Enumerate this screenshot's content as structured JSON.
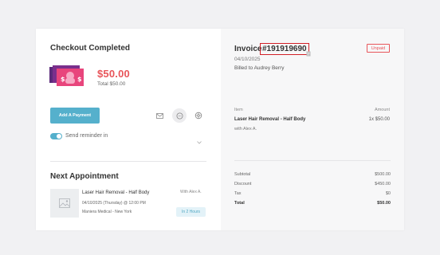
{
  "checkout": {
    "title": "Checkout Completed",
    "amount": "$50.00",
    "total_line": "Total $50.00",
    "pay_button": "Add A Payment",
    "reminder_label": "Send reminder in",
    "reminder_enabled": true
  },
  "next_appointment": {
    "title": "Next Appointment",
    "service": "Laser Hair Removal - Half Body",
    "date": "04/10/2025 (Thursday) @ 12:00 PM",
    "location": "Maniera Medical - New York",
    "with": "With Alex A.",
    "badge": "In 2 Hours"
  },
  "invoice": {
    "label": "Invoice",
    "number": "#191919690",
    "status": "Unpaid",
    "date": "04/10/2025",
    "billed_to": "Billed to Audrey Berry",
    "columns": {
      "item": "Item",
      "amount": "Amount"
    },
    "line": {
      "name": "Laser Hair Removal - Half Body",
      "amount": "1x $50.00",
      "with": "with Alex A."
    },
    "totals": [
      {
        "label": "Subtotal",
        "value": "$500.00"
      },
      {
        "label": "Discount",
        "value": "$450.00"
      },
      {
        "label": "Tax",
        "value": "$0"
      },
      {
        "label": "Total",
        "value": "$50.00"
      }
    ]
  },
  "colors": {
    "accent": "#55b0cc",
    "alert": "#e8555a",
    "highlight_box": "#d12027"
  },
  "icons": [
    "money-icon",
    "mail-icon",
    "sms-icon",
    "print-icon",
    "chevron-down-icon",
    "copy-icon",
    "appointment-thumb-icon"
  ]
}
